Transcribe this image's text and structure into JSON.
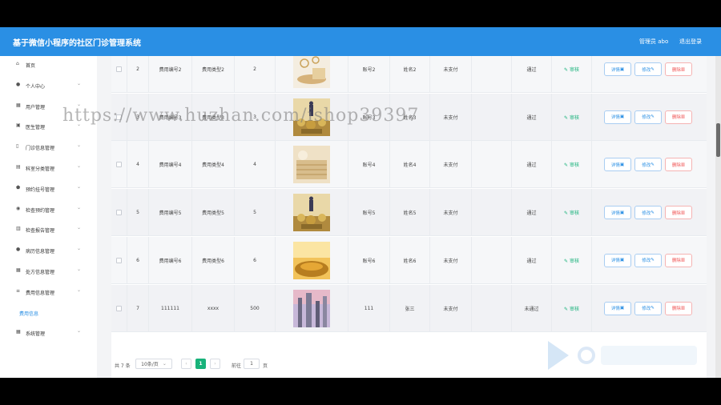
{
  "header": {
    "title": "基于微信小程序的社区门诊管理系统",
    "user": "管理员 abo",
    "logout": "退出登录"
  },
  "sidebar": {
    "items": [
      {
        "label": "首页",
        "icon": "home-icon",
        "chevron": false
      },
      {
        "label": "个人中心",
        "icon": "person-icon",
        "chevron": true
      },
      {
        "label": "用户管理",
        "icon": "grid-icon",
        "chevron": true
      },
      {
        "label": "医生管理",
        "icon": "doctor-icon",
        "chevron": true
      },
      {
        "label": "门诊信息管理",
        "icon": "clinic-icon",
        "chevron": true
      },
      {
        "label": "科室分类管理",
        "icon": "department-icon",
        "chevron": true
      },
      {
        "label": "预约挂号管理",
        "icon": "shield-icon",
        "chevron": true
      },
      {
        "label": "检查预约管理",
        "icon": "database-icon",
        "chevron": true
      },
      {
        "label": "检查报告管理",
        "icon": "report-icon",
        "chevron": true
      },
      {
        "label": "病历信息管理",
        "icon": "record-icon",
        "chevron": true
      },
      {
        "label": "处方信息管理",
        "icon": "prescription-icon",
        "chevron": true
      },
      {
        "label": "费用信息管理",
        "icon": "fee-icon",
        "chevron": true
      },
      {
        "label": "费用信息",
        "icon": "",
        "chevron": false,
        "sub": true
      },
      {
        "label": "系统管理",
        "icon": "settings-icon",
        "chevron": true
      }
    ]
  },
  "table": {
    "rows": [
      {
        "num": "2",
        "code": "费用编号2",
        "type": "费用类型2",
        "amount": "2",
        "account": "账号2",
        "name": "姓名2",
        "paid": "未支付",
        "status": "通过",
        "thumb": "coins"
      },
      {
        "num": "3",
        "code": "费用编号3",
        "type": "费用类型3",
        "amount": "3",
        "account": "账号3",
        "name": "姓名3",
        "paid": "未支付",
        "status": "通过",
        "thumb": "business"
      },
      {
        "num": "4",
        "code": "费用编号4",
        "type": "费用类型4",
        "amount": "4",
        "account": "账号4",
        "name": "姓名4",
        "paid": "未支付",
        "status": "通过",
        "thumb": "stacks"
      },
      {
        "num": "5",
        "code": "费用编号5",
        "type": "费用类型5",
        "amount": "5",
        "account": "账号5",
        "name": "姓名5",
        "paid": "未支付",
        "status": "通过",
        "thumb": "business"
      },
      {
        "num": "6",
        "code": "费用编号6",
        "type": "费用类型6",
        "amount": "6",
        "account": "账号6",
        "name": "姓名6",
        "paid": "未支付",
        "status": "通过",
        "thumb": "gold"
      },
      {
        "num": "7",
        "code": "111111",
        "type": "xxxx",
        "amount": "500",
        "account": "111",
        "name": "张三",
        "paid": "未支付",
        "status": "未通过",
        "thumb": "city"
      }
    ],
    "audit_label": "审核",
    "detail_label": "详情",
    "edit_label": "修改",
    "delete_label": "删除"
  },
  "pagination": {
    "total": "共 7 条",
    "page_size": "10条/页",
    "current": "1",
    "goto_label": "前往",
    "goto_value": "1",
    "page_unit": "页"
  },
  "watermark": "https://www.huzhan.com/ishop39397"
}
